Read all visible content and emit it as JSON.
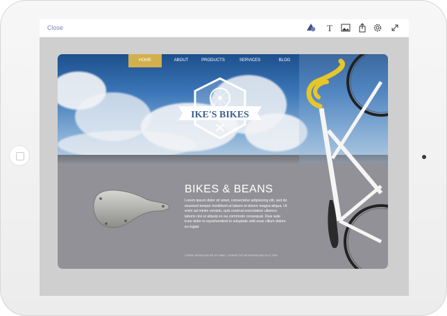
{
  "toolbar": {
    "close_label": "Close",
    "icons": [
      "shapes-icon",
      "text-icon",
      "image-icon",
      "share-icon",
      "settings-icon",
      "fullscreen-icon"
    ],
    "text_icon_glyph": "T"
  },
  "site": {
    "nav": [
      "HOME",
      "ABOUT",
      "PRODUCTS",
      "SERVICES",
      "BLOG"
    ],
    "active_nav": "HOME",
    "logo_text": "IKE'S BIKES",
    "heading": "BIKES & BEANS",
    "body": "Lorem ipsum dolor sit amet, consectetur adipisicing elit, sed do eiusmod tempor incididunt ut labore et dolore magna aliqua. Ut enim ad minim veniam, quis nostrud exercitation ullamco laboris nisi ut aliquip ex ea commodo consequat. Duis aute irure dolor in reprehenderit in voluptate velit esse cillum dolore eu fugiat",
    "footer": "LOREM IPSUM DOLOR SIT AMET, CONSECTETUR ADIPISICING ELIT, SED"
  },
  "colors": {
    "accent_nav": "#d2b04d",
    "close_text": "#7a86b8",
    "canvas_gray": "#919197"
  }
}
